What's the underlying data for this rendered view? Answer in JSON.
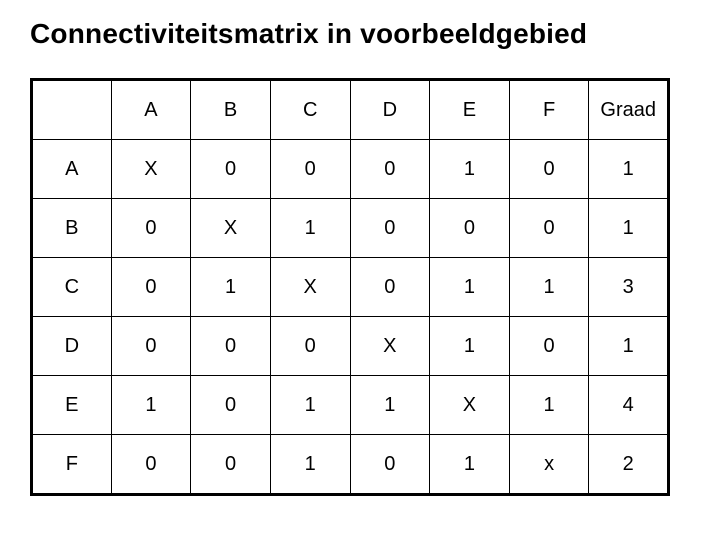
{
  "title": "Connectiviteitsmatrix in voorbeeldgebied",
  "chart_data": {
    "type": "table",
    "columns": [
      "",
      "A",
      "B",
      "C",
      "D",
      "E",
      "F",
      "Graad"
    ],
    "rows": [
      [
        "A",
        "X",
        "0",
        "0",
        "0",
        "1",
        "0",
        "1"
      ],
      [
        "B",
        "0",
        "X",
        "1",
        "0",
        "0",
        "0",
        "1"
      ],
      [
        "C",
        "0",
        "1",
        "X",
        "0",
        "1",
        "1",
        "3"
      ],
      [
        "D",
        "0",
        "0",
        "0",
        "X",
        "1",
        "0",
        "1"
      ],
      [
        "E",
        "1",
        "0",
        "1",
        "1",
        "X",
        "1",
        "4"
      ],
      [
        "F",
        "0",
        "0",
        "1",
        "0",
        "1",
        "x",
        "2"
      ]
    ]
  }
}
